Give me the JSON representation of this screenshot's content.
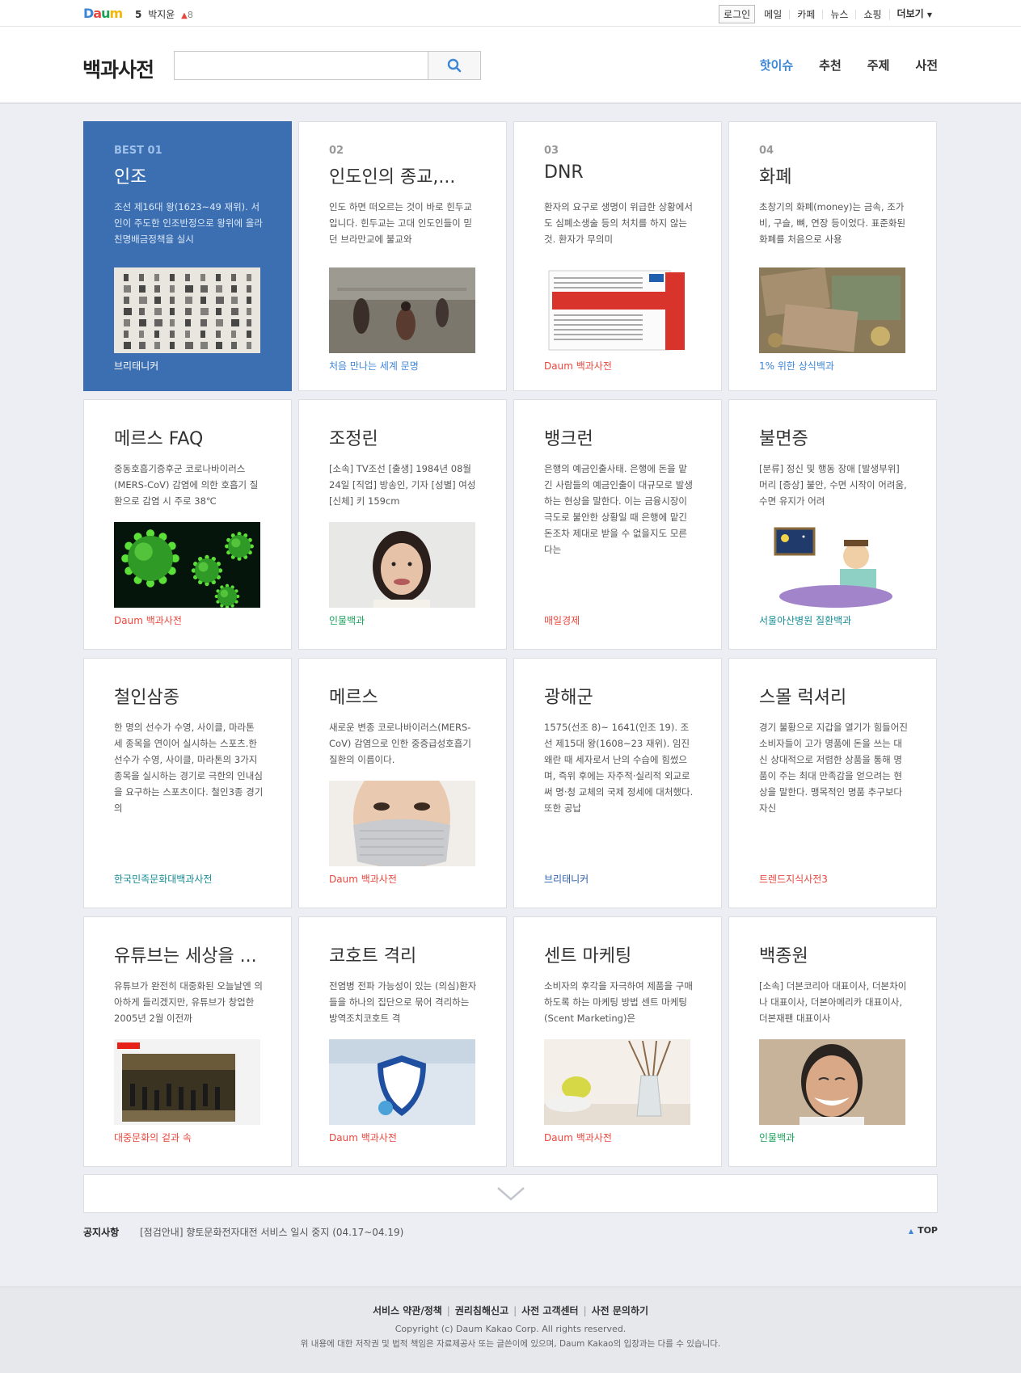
{
  "topbar": {
    "logo": "Daum",
    "rank": {
      "number": "5",
      "name": "박지윤",
      "change": "8"
    },
    "login_label": "로그인",
    "links": [
      "메일",
      "카페",
      "뉴스",
      "쇼핑"
    ],
    "more_label": "더보기"
  },
  "header": {
    "title": "백과사전",
    "search_placeholder": "",
    "nav": [
      {
        "label": "핫이슈",
        "active": true
      },
      {
        "label": "추천",
        "active": false
      },
      {
        "label": "주제",
        "active": false
      },
      {
        "label": "사전",
        "active": false
      }
    ]
  },
  "cards": [
    {
      "index": "BEST 01",
      "title": "인조",
      "desc": "조선 제16대 왕(1623~49 재위). 서인이 주도한 인조반정으로 왕위에 올라 친명배금정책을 실시",
      "image": "calligraphy",
      "source": "브리태니커",
      "source_color": "white",
      "best": true
    },
    {
      "index": "02",
      "title": "인도인의 종교,...",
      "desc": "인도 하면 떠오르는 것이 바로 힌두교입니다. 힌두교는 고대 인도인들이 믿던 브라만교에 불교와",
      "image": "river-bathing",
      "source": "처음 만나는 세계 문명",
      "source_color": "blue"
    },
    {
      "index": "03",
      "title": "DNR",
      "desc": "환자의 요구로 생명이 위급한 상황에서도 심폐소생술 등의 처치를 하지 않는 것. 환자가 무의미",
      "image": "dnr-form",
      "source": "Daum 백과사전",
      "source_color": "red"
    },
    {
      "index": "04",
      "title": "화폐",
      "desc": "초창기의 화폐(money)는 금속, 조가비, 구슬, 뼈, 연장 등이었다. 표준화된 화폐를 처음으로 사용",
      "image": "banknotes",
      "source": "1% 위한 상식백과",
      "source_color": "blue"
    },
    {
      "index": "",
      "title": "메르스 FAQ",
      "desc": "중동호흡기증후군 코로나바이러스(MERS-CoV) 감염에 의한 호흡기 질환으로 감염 시 주로 38℃",
      "image": "virus",
      "source": "Daum 백과사전",
      "source_color": "red"
    },
    {
      "index": "",
      "title": "조정린",
      "desc": "[소속] TV조선 [출생] 1984년 08월 24일 [직업] 방송인, 기자 [성별] 여성 [신체] 키 159cm",
      "image": "portrait-woman",
      "source": "인물백과",
      "source_color": "green"
    },
    {
      "index": "",
      "title": "뱅크런",
      "desc": "은행의 예금인출사태. 은행에 돈을 맡긴 사람들의 예금인출이 대규모로 발생하는 현상을 말한다. 이는 금융시장이 극도로 불안한 상황일 때 은행에 맡긴 돈조차 제대로 받을 수 없을지도 모른다는",
      "image": "",
      "source": "매일경제",
      "source_color": "red"
    },
    {
      "index": "",
      "title": "불면증",
      "desc": "[분류] 정신 및 행동 장애 [발생부위] 머리 [증상] 불안, 수면 시작이 어려움, 수면 유지가 어려",
      "image": "insomnia",
      "source": "서울아산병원 질환백과",
      "source_color": "teal"
    },
    {
      "index": "",
      "title": "철인삼종",
      "desc": "한 명의 선수가 수영, 사이클, 마라톤 세 종목을 연이어 실시하는 스포츠.한 선수가 수영, 사이클, 마라톤의 3가지 종목을 실시하는 경기로 극한의 인내심을 요구하는 스포츠이다. 철인3종 경기의",
      "image": "",
      "source": "한국민족문화대백과사전",
      "source_color": "teal"
    },
    {
      "index": "",
      "title": "메르스",
      "desc": "새로운 변종 코로나바이러스(MERS-CoV) 감염으로 인한 중증급성호흡기질환의 이름이다.",
      "image": "mask",
      "source": "Daum 백과사전",
      "source_color": "red"
    },
    {
      "index": "",
      "title": "광해군",
      "desc": "1575(선조 8)~ 1641(인조 19). 조선 제15대 왕(1608~23 재위). 임진왜란 때 세자로서 난의 수습에 힘썼으며, 즉위 후에는 자주적·실리적 외교로써 명·청 교체의 국제 정세에 대처했다.또한 공납",
      "image": "",
      "source": "브리태니커",
      "source_color": "navy"
    },
    {
      "index": "",
      "title": "스몰 럭셔리",
      "desc": "경기 불황으로 지갑을 열기가 힘들어진 소비자들이 고가 명품에 돈을 쓰는 대신 상대적으로 저렴한 상품을 통해 명품이 주는 최대 만족감을 얻으려는 현상을 말한다. 맹목적인 명품 추구보다 자신",
      "image": "",
      "source": "트렌드지식사전3",
      "source_color": "red"
    },
    {
      "index": "",
      "title": "유튜브는 세상을 ...",
      "desc": "유튜브가 완전히 대중화된 오늘날엔 의아하게 들리겠지만, 유튜브가 창업한 2005년 2월 이전까",
      "image": "youtube",
      "source": "대중문화의 겉과 속",
      "source_color": "red"
    },
    {
      "index": "",
      "title": "코호트 격리",
      "desc": "전염병 전파 가능성이 있는 (의심)환자들을 하나의 집단으로 묶어 격리하는 방역조치코호트 격",
      "image": "isolation",
      "source": "Daum 백과사전",
      "source_color": "red"
    },
    {
      "index": "",
      "title": "센트 마케팅",
      "desc": "소비자의 후각을 자극하여 제품을 구매하도록 하는 마케팅 방법 센트 마케팅(Scent Marketing)은",
      "image": "diffuser",
      "source": "Daum 백과사전",
      "source_color": "red"
    },
    {
      "index": "",
      "title": "백종원",
      "desc": "[소속] 더본코리아 대표이사, 더본차이나 대표이사, 더본아메리카 대표이사, 더본재팬 대표이사",
      "image": "portrait-man",
      "source": "인물백과",
      "source_color": "green"
    }
  ],
  "notice": {
    "label": "공지사항",
    "text": "[점검안내] 향토문화전자대전 서비스 일시 중지 (04.17~04.19)",
    "top_label": "TOP"
  },
  "footer": {
    "links": [
      "서비스 약관/정책",
      "권리침해신고",
      "사전 고객센터",
      "사전 문의하기"
    ],
    "copyright": "Copyright (c) Daum Kakao Corp. All rights reserved.",
    "note": "위 내용에 대한 저작권 및 법적 책임은 자료제공사 또는 글쓴이에 있으며, Daum Kakao의 입장과는 다를 수 있습니다."
  }
}
